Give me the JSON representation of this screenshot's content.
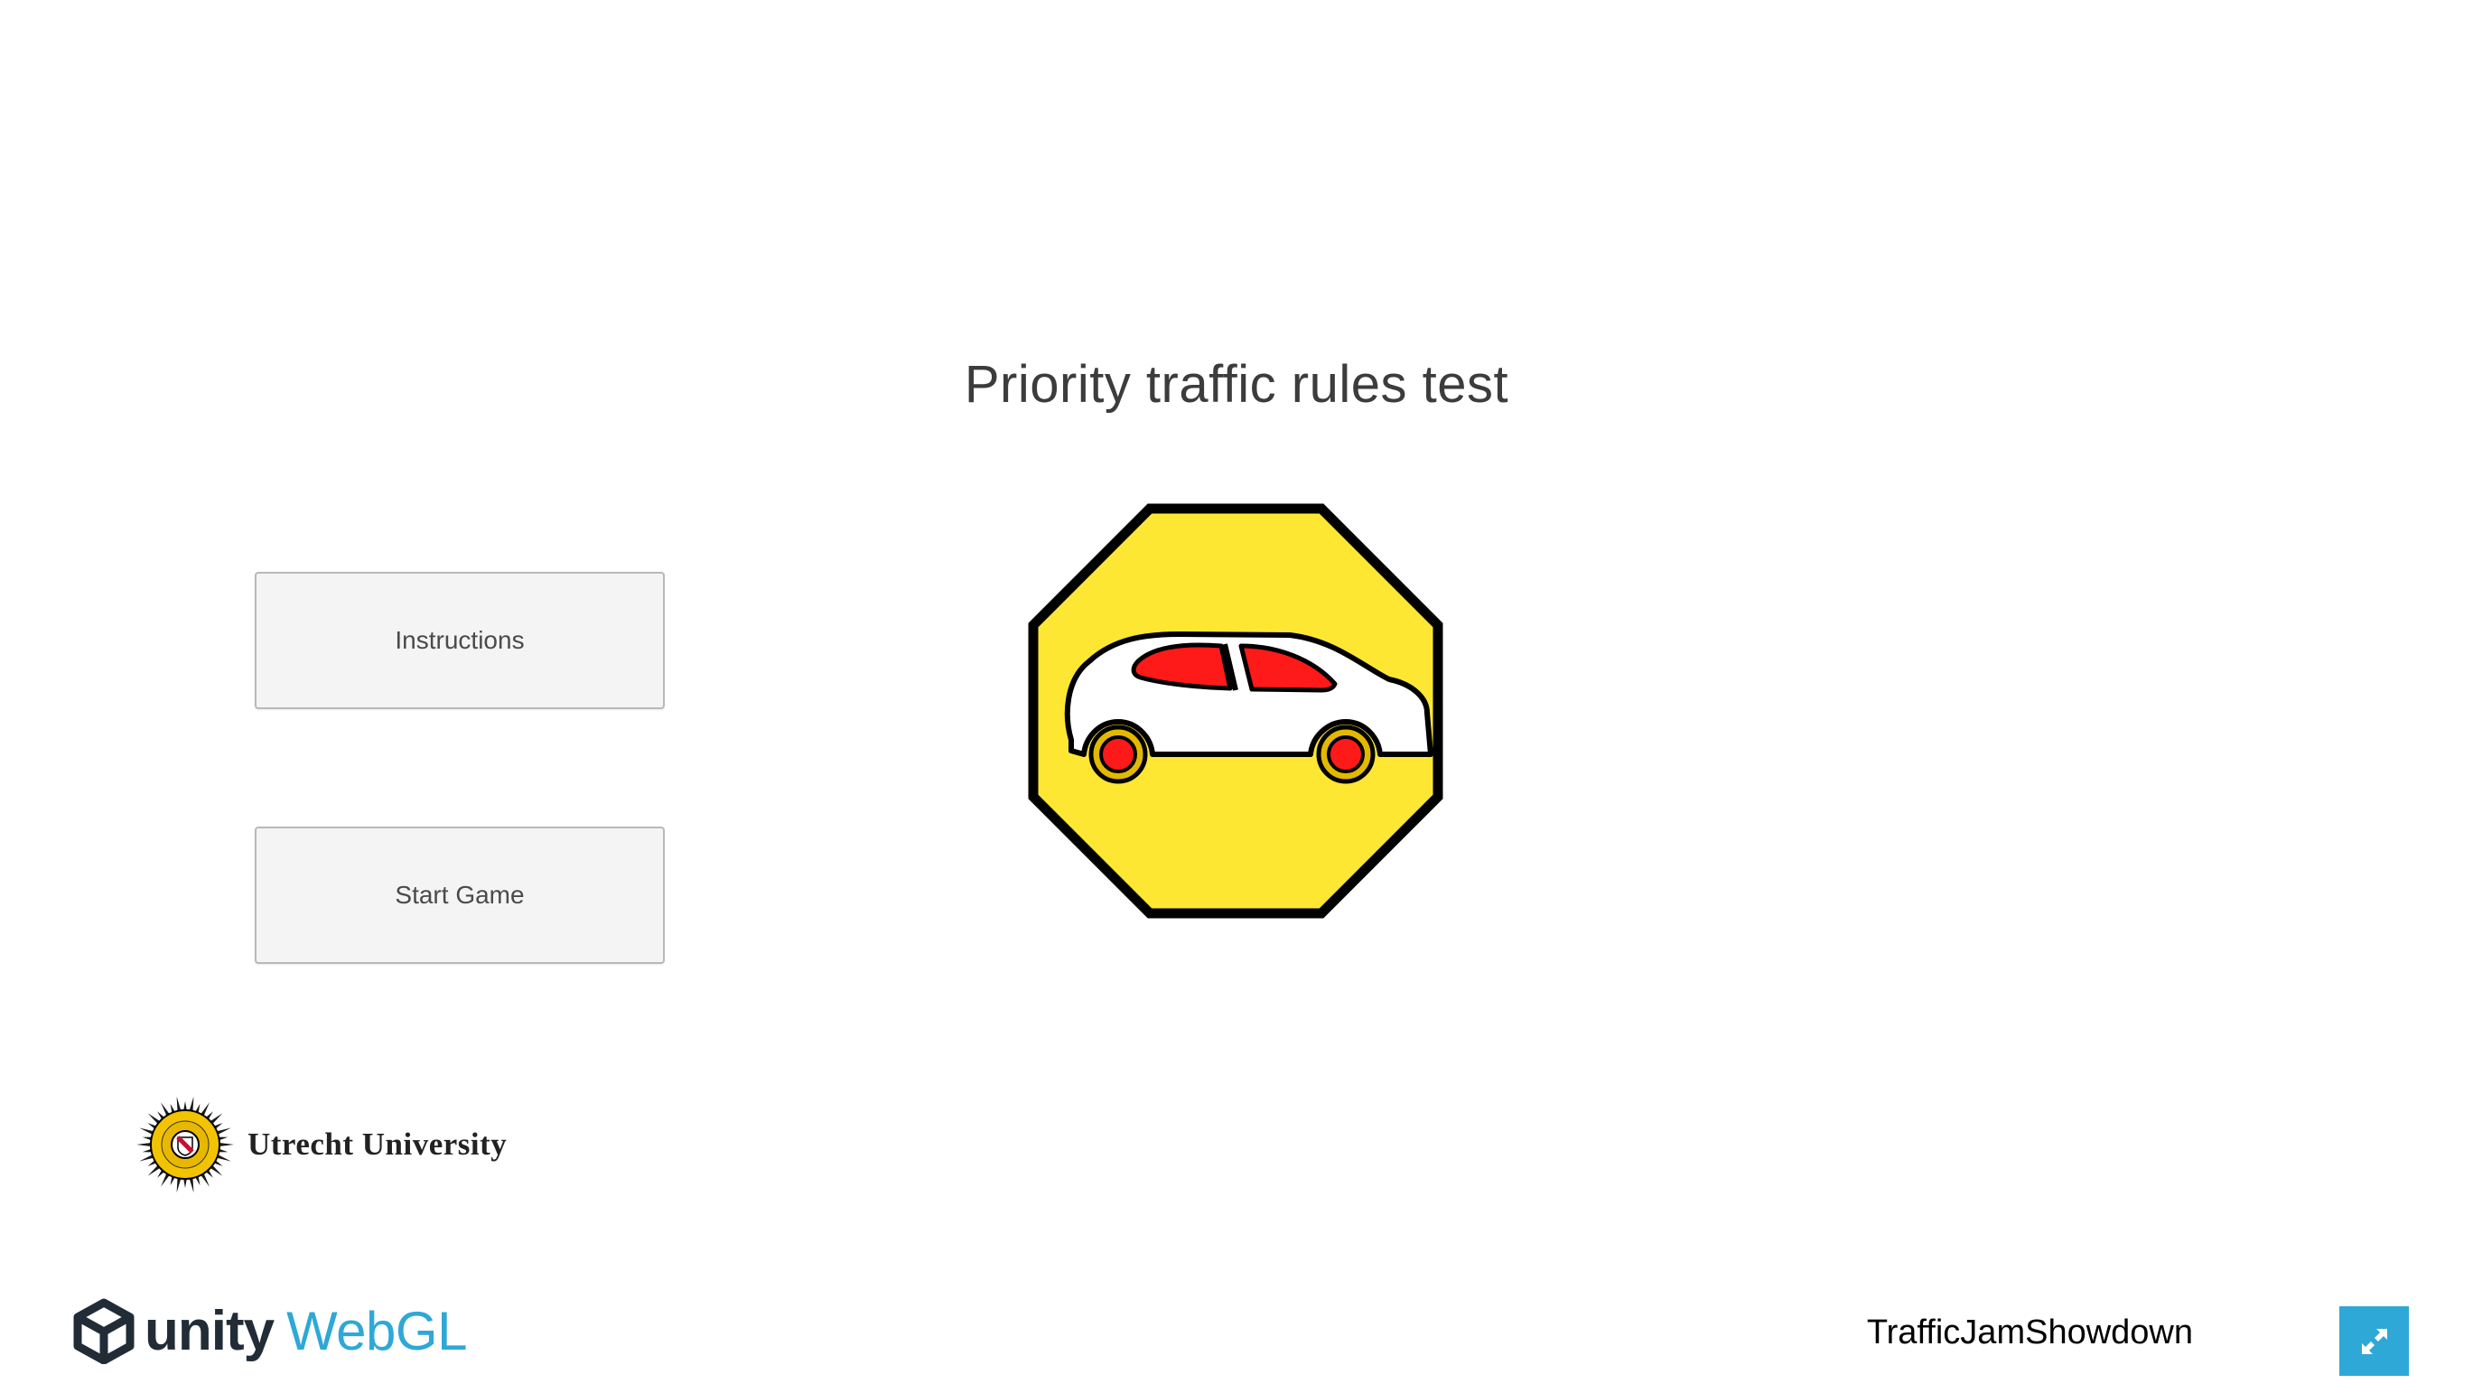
{
  "game": {
    "title": "Priority traffic rules test",
    "buttons": {
      "instructions_label": "Instructions",
      "start_label": "Start Game"
    },
    "university_name": "Utrecht University",
    "sign_colors": {
      "sign_fill": "#fde733",
      "car_body": "#ffffff",
      "car_windows": "#ff1a1a",
      "wheels": "#ff1a1a",
      "rims": "#e3b800",
      "outline": "#000000"
    }
  },
  "footer": {
    "unity_label": "unity",
    "webgl_label": "WebGL",
    "game_name": "TrafficJamShowdown",
    "fullscreen_icon": "fullscreen-icon",
    "accent_color": "#2ea8d6"
  }
}
